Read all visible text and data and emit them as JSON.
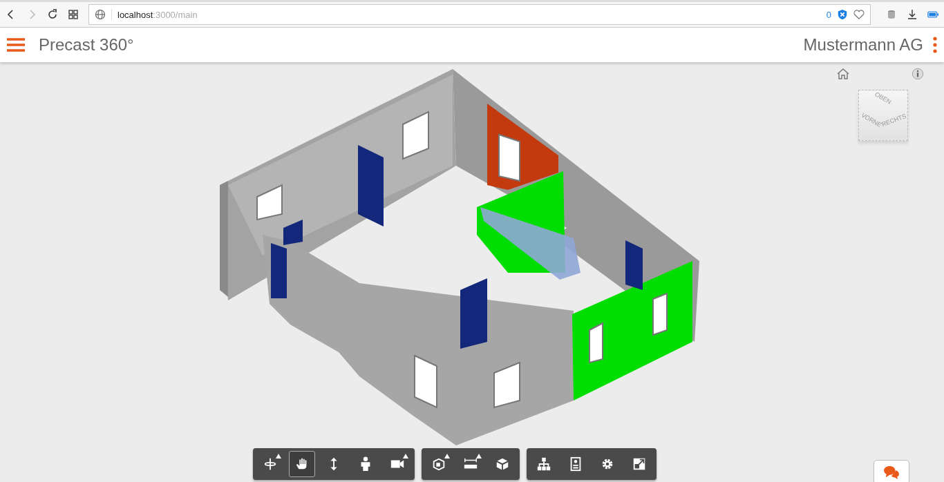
{
  "browser": {
    "url_host": "localhost",
    "url_path": ":3000/main",
    "blocker_count": "0"
  },
  "header": {
    "title": "Precast 360°",
    "company": "Mustermann AG"
  },
  "viewcube": {
    "top": "OBEN",
    "front": "VORNE",
    "right": "RECHTS"
  },
  "toolbar": [
    {
      "tools": [
        {
          "selected": false,
          "menu": true
        },
        {
          "selected": true,
          "menu": false
        },
        {
          "selected": false,
          "menu": false
        },
        {
          "selected": false,
          "menu": false
        },
        {
          "selected": false,
          "menu": true
        }
      ]
    },
    {
      "tools": [
        {
          "selected": false,
          "menu": true
        },
        {
          "selected": false,
          "menu": true
        },
        {
          "selected": false,
          "menu": false
        }
      ]
    },
    {
      "tools": [
        {
          "selected": false,
          "menu": false
        },
        {
          "selected": false,
          "menu": false
        },
        {
          "selected": false,
          "menu": false
        },
        {
          "selected": false,
          "menu": false
        }
      ]
    }
  ]
}
